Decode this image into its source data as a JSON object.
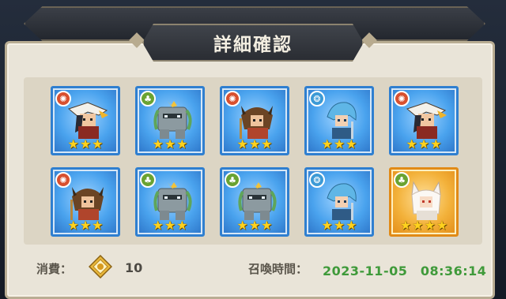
{
  "dialog": {
    "title": "詳細確認"
  },
  "summons": [
    {
      "element": "fire",
      "stars": 3,
      "rarity": "blue",
      "character": "eagle-helm-warrior"
    },
    {
      "element": "earth",
      "stars": 3,
      "rarity": "blue",
      "character": "stone-golem"
    },
    {
      "element": "fire",
      "stars": 3,
      "rarity": "blue",
      "character": "horned-brown-hair-warrior"
    },
    {
      "element": "water",
      "stars": 3,
      "rarity": "blue",
      "character": "blue-hair-swordsman"
    },
    {
      "element": "fire",
      "stars": 3,
      "rarity": "blue",
      "character": "eagle-helm-warrior"
    },
    {
      "element": "fire",
      "stars": 3,
      "rarity": "blue",
      "character": "horned-brown-hair-warrior"
    },
    {
      "element": "earth",
      "stars": 3,
      "rarity": "blue",
      "character": "stone-golem"
    },
    {
      "element": "earth",
      "stars": 3,
      "rarity": "blue",
      "character": "stone-golem"
    },
    {
      "element": "water",
      "stars": 3,
      "rarity": "blue",
      "character": "blue-hair-swordsman"
    },
    {
      "element": "earth",
      "stars": 4,
      "rarity": "gold",
      "character": "white-fox-girl"
    }
  ],
  "footer": {
    "cost_label": "消費：",
    "cost_value": "10",
    "time_label": "召喚時間：",
    "time_value": "2023-11-05　08:36:14"
  },
  "colors": {
    "fire": "#d8502f",
    "earth": "#6aa332",
    "water": "#3c9ad6",
    "time_text": "#3f9a3a"
  }
}
